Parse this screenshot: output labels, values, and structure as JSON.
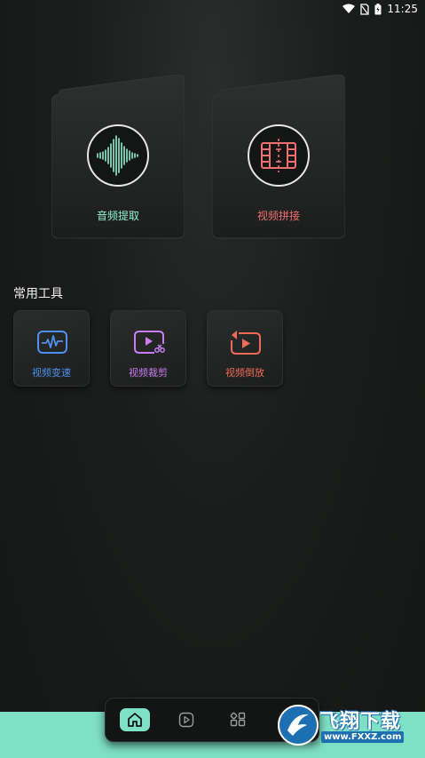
{
  "status_bar": {
    "time": "11:25",
    "icons": [
      "wifi-icon",
      "no-sim-icon",
      "battery-icon"
    ]
  },
  "main_cards": [
    {
      "label": "音频提取",
      "icon": "waveform-icon",
      "color": "#8ff0cf"
    },
    {
      "label": "视频拼接",
      "icon": "film-strip-icon",
      "color": "#f07070"
    }
  ],
  "section_title": "常用工具",
  "tools": [
    {
      "label": "视频变速",
      "icon": "speed-waveform-icon",
      "color": "#4f8ff0"
    },
    {
      "label": "视频裁剪",
      "icon": "video-cut-icon",
      "color": "#c77ef0"
    },
    {
      "label": "视频倒放",
      "icon": "video-reverse-icon",
      "color": "#f06a5a"
    }
  ],
  "nav": [
    {
      "name": "home",
      "icon": "home-icon",
      "active": true
    },
    {
      "name": "video",
      "icon": "play-icon",
      "active": false
    },
    {
      "name": "apps",
      "icon": "grid-icon",
      "active": false
    }
  ],
  "watermark": {
    "text": "飞翔下载",
    "url": "www.FXXZ.com"
  },
  "colors": {
    "accent": "#7ee0c4",
    "background": "#1b1d1c"
  }
}
